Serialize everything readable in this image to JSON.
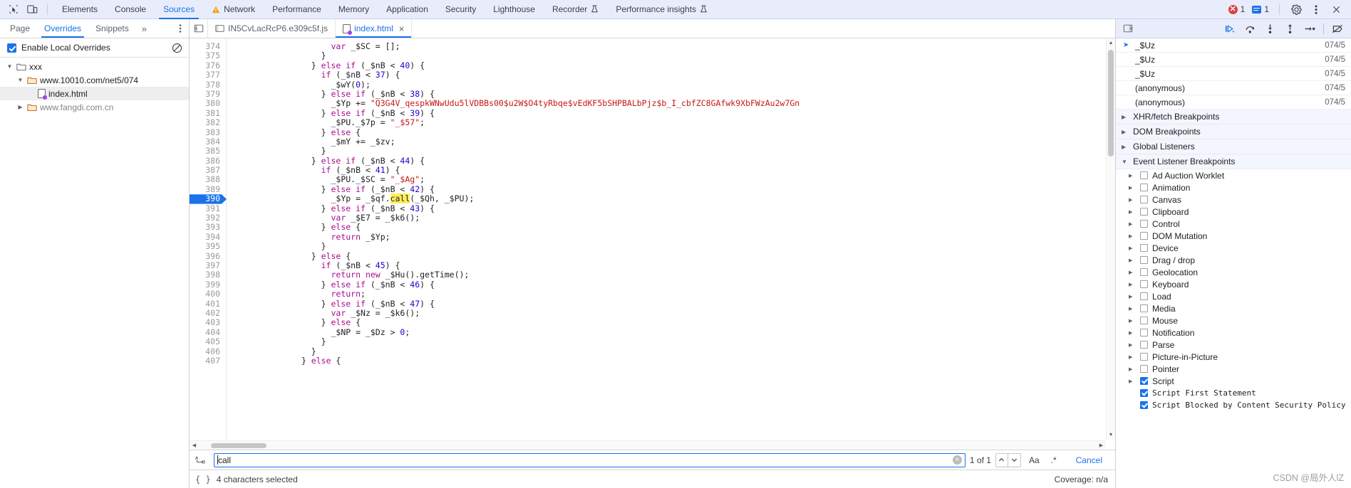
{
  "toolbar": {
    "inspect_icon": "inspect-cursor-icon",
    "device_icon": "device-toggle-icon",
    "tabs": [
      {
        "label": "Elements",
        "active": false,
        "warn": false,
        "flask": false
      },
      {
        "label": "Console",
        "active": false,
        "warn": false,
        "flask": false
      },
      {
        "label": "Sources",
        "active": true,
        "warn": false,
        "flask": false
      },
      {
        "label": "Network",
        "active": false,
        "warn": true,
        "flask": false
      },
      {
        "label": "Performance",
        "active": false,
        "warn": false,
        "flask": false
      },
      {
        "label": "Memory",
        "active": false,
        "warn": false,
        "flask": false
      },
      {
        "label": "Application",
        "active": false,
        "warn": false,
        "flask": false
      },
      {
        "label": "Security",
        "active": false,
        "warn": false,
        "flask": false
      },
      {
        "label": "Lighthouse",
        "active": false,
        "warn": false,
        "flask": false
      },
      {
        "label": "Recorder",
        "active": false,
        "warn": false,
        "flask": true
      },
      {
        "label": "Performance insights",
        "active": false,
        "warn": false,
        "flask": true
      }
    ],
    "error_count": "1",
    "message_count": "1",
    "settings_icon": "gear-icon",
    "kebab_icon": "more-options-icon",
    "close_icon": "close-devtools-icon"
  },
  "navigator": {
    "tabs": [
      {
        "label": "Page",
        "active": false
      },
      {
        "label": "Overrides",
        "active": true
      },
      {
        "label": "Snippets",
        "active": false
      }
    ],
    "more_label": "»",
    "kebab_icon": "more-options-icon",
    "enable_overrides_label": "Enable Local Overrides",
    "enable_overrides_checked": true,
    "clear_icon": "clear-configuration-icon",
    "tree": [
      {
        "label": "xxx",
        "depth": 0,
        "expanded": true,
        "kind": "folder-plain",
        "selected": false,
        "dim": false
      },
      {
        "label": "www.10010.com/net5/074",
        "depth": 1,
        "expanded": true,
        "kind": "folder-override",
        "selected": false,
        "dim": false
      },
      {
        "label": "index.html",
        "depth": 2,
        "expanded": null,
        "kind": "file-override",
        "selected": true,
        "dim": false
      },
      {
        "label": "www.fangdi.com.cn",
        "depth": 1,
        "expanded": false,
        "kind": "folder-override",
        "selected": false,
        "dim": true
      }
    ]
  },
  "editor": {
    "panel_toggle_icon": "show-navigator-icon",
    "tabs": [
      {
        "label": "IN5CvLacRcP6.e309c5f.js",
        "active": false,
        "override": false,
        "closeable": false
      },
      {
        "label": "index.html",
        "active": true,
        "override": true,
        "closeable": true
      }
    ],
    "close_label": "×",
    "first_line": 374,
    "highlight_line": 390,
    "lines": [
      {
        "n": 374,
        "indent": 20,
        "tokens": [
          [
            "kw",
            "var"
          ],
          [
            "pl",
            " _$SC = [];"
          ]
        ]
      },
      {
        "n": 375,
        "indent": 18,
        "tokens": [
          [
            "pl",
            "}"
          ]
        ]
      },
      {
        "n": 376,
        "indent": 16,
        "tokens": [
          [
            "pl",
            "} "
          ],
          [
            "kw",
            "else if"
          ],
          [
            "pl",
            " (_$nB < "
          ],
          [
            "num",
            "40"
          ],
          [
            "pl",
            ") {"
          ]
        ]
      },
      {
        "n": 377,
        "indent": 18,
        "tokens": [
          [
            "kw",
            "if"
          ],
          [
            "pl",
            " (_$nB < "
          ],
          [
            "num",
            "37"
          ],
          [
            "pl",
            ") {"
          ]
        ]
      },
      {
        "n": 378,
        "indent": 20,
        "tokens": [
          [
            "pl",
            "_$wY("
          ],
          [
            "num",
            "0"
          ],
          [
            "pl",
            ");"
          ]
        ]
      },
      {
        "n": 379,
        "indent": 18,
        "tokens": [
          [
            "pl",
            "} "
          ],
          [
            "kw",
            "else if"
          ],
          [
            "pl",
            " (_$nB < "
          ],
          [
            "num",
            "38"
          ],
          [
            "pl",
            ") {"
          ]
        ]
      },
      {
        "n": 380,
        "indent": 20,
        "tokens": [
          [
            "pl",
            "_$Yp += "
          ],
          [
            "str",
            "\"Q3G4V_qespkWNwUdu5lVDBBs00$u2W$O4tyRbqe$vEdKF5bSHPBALbPjz$b_I_cbfZC8GAfwk9XbFWzAu2w7Gn"
          ]
        ]
      },
      {
        "n": 381,
        "indent": 18,
        "tokens": [
          [
            "pl",
            "} "
          ],
          [
            "kw",
            "else if"
          ],
          [
            "pl",
            " (_$nB < "
          ],
          [
            "num",
            "39"
          ],
          [
            "pl",
            ") {"
          ]
        ]
      },
      {
        "n": 382,
        "indent": 20,
        "tokens": [
          [
            "pl",
            "_$PU._$7p = "
          ],
          [
            "str",
            "\"_$57\""
          ],
          [
            "pl",
            ";"
          ]
        ]
      },
      {
        "n": 383,
        "indent": 18,
        "tokens": [
          [
            "pl",
            "} "
          ],
          [
            "kw",
            "else"
          ],
          [
            "pl",
            " {"
          ]
        ]
      },
      {
        "n": 384,
        "indent": 20,
        "tokens": [
          [
            "pl",
            "_$mY += _$zv;"
          ]
        ]
      },
      {
        "n": 385,
        "indent": 18,
        "tokens": [
          [
            "pl",
            "}"
          ]
        ]
      },
      {
        "n": 386,
        "indent": 16,
        "tokens": [
          [
            "pl",
            "} "
          ],
          [
            "kw",
            "else if"
          ],
          [
            "pl",
            " (_$nB < "
          ],
          [
            "num",
            "44"
          ],
          [
            "pl",
            ") {"
          ]
        ]
      },
      {
        "n": 387,
        "indent": 18,
        "tokens": [
          [
            "kw",
            "if"
          ],
          [
            "pl",
            " (_$nB < "
          ],
          [
            "num",
            "41"
          ],
          [
            "pl",
            ") {"
          ]
        ]
      },
      {
        "n": 388,
        "indent": 20,
        "tokens": [
          [
            "pl",
            "_$PU._$SC = "
          ],
          [
            "str",
            "\"_$Ag\""
          ],
          [
            "pl",
            ";"
          ]
        ]
      },
      {
        "n": 389,
        "indent": 18,
        "tokens": [
          [
            "pl",
            "} "
          ],
          [
            "kw",
            "else if"
          ],
          [
            "pl",
            " (_$nB < "
          ],
          [
            "num",
            "42"
          ],
          [
            "pl",
            ") {"
          ]
        ]
      },
      {
        "n": 390,
        "indent": 20,
        "tokens": [
          [
            "pl",
            "_$Yp = _$qf."
          ],
          [
            "mark",
            "call"
          ],
          [
            "pl",
            "(_$Qh, _$PU);"
          ]
        ]
      },
      {
        "n": 391,
        "indent": 18,
        "tokens": [
          [
            "pl",
            "} "
          ],
          [
            "kw",
            "else if"
          ],
          [
            "pl",
            " (_$nB < "
          ],
          [
            "num",
            "43"
          ],
          [
            "pl",
            ") {"
          ]
        ]
      },
      {
        "n": 392,
        "indent": 20,
        "tokens": [
          [
            "kw",
            "var"
          ],
          [
            "pl",
            " _$E7 = _$k6();"
          ]
        ]
      },
      {
        "n": 393,
        "indent": 18,
        "tokens": [
          [
            "pl",
            "} "
          ],
          [
            "kw",
            "else"
          ],
          [
            "pl",
            " {"
          ]
        ]
      },
      {
        "n": 394,
        "indent": 20,
        "tokens": [
          [
            "kw",
            "return"
          ],
          [
            "pl",
            " _$Yp;"
          ]
        ]
      },
      {
        "n": 395,
        "indent": 18,
        "tokens": [
          [
            "pl",
            "}"
          ]
        ]
      },
      {
        "n": 396,
        "indent": 16,
        "tokens": [
          [
            "pl",
            "} "
          ],
          [
            "kw",
            "else"
          ],
          [
            "pl",
            " {"
          ]
        ]
      },
      {
        "n": 397,
        "indent": 18,
        "tokens": [
          [
            "kw",
            "if"
          ],
          [
            "pl",
            " (_$nB < "
          ],
          [
            "num",
            "45"
          ],
          [
            "pl",
            ") {"
          ]
        ]
      },
      {
        "n": 398,
        "indent": 20,
        "tokens": [
          [
            "kw",
            "return new"
          ],
          [
            "pl",
            " _$Hu().getTime();"
          ]
        ]
      },
      {
        "n": 399,
        "indent": 18,
        "tokens": [
          [
            "pl",
            "} "
          ],
          [
            "kw",
            "else if"
          ],
          [
            "pl",
            " (_$nB < "
          ],
          [
            "num",
            "46"
          ],
          [
            "pl",
            ") {"
          ]
        ]
      },
      {
        "n": 400,
        "indent": 20,
        "tokens": [
          [
            "kw",
            "return"
          ],
          [
            "pl",
            ";"
          ]
        ]
      },
      {
        "n": 401,
        "indent": 18,
        "tokens": [
          [
            "pl",
            "} "
          ],
          [
            "kw",
            "else if"
          ],
          [
            "pl",
            " (_$nB < "
          ],
          [
            "num",
            "47"
          ],
          [
            "pl",
            ") {"
          ]
        ]
      },
      {
        "n": 402,
        "indent": 20,
        "tokens": [
          [
            "kw",
            "var"
          ],
          [
            "pl",
            " _$Nz = _$k6();"
          ]
        ]
      },
      {
        "n": 403,
        "indent": 18,
        "tokens": [
          [
            "pl",
            "} "
          ],
          [
            "kw",
            "else"
          ],
          [
            "pl",
            " {"
          ]
        ]
      },
      {
        "n": 404,
        "indent": 20,
        "tokens": [
          [
            "pl",
            "_$NP = _$Dz > "
          ],
          [
            "num",
            "0"
          ],
          [
            "pl",
            ";"
          ]
        ]
      },
      {
        "n": 405,
        "indent": 18,
        "tokens": [
          [
            "pl",
            "}"
          ]
        ]
      },
      {
        "n": 406,
        "indent": 16,
        "tokens": [
          [
            "pl",
            "}"
          ]
        ]
      },
      {
        "n": 407,
        "indent": 14,
        "tokens": [
          [
            "pl",
            "} "
          ],
          [
            "kw",
            "else"
          ],
          [
            "pl",
            " {"
          ]
        ]
      }
    ]
  },
  "search": {
    "regex_icon": "match-case-icon",
    "value": "call",
    "placeholder": "Find",
    "clear_label": "×",
    "match_count": "1 of 1",
    "prev_label": "⌃",
    "next_label": "⌄",
    "match_case_label": "Aa",
    "regex_label": ".*",
    "cancel_label": "Cancel"
  },
  "status": {
    "format_icon": "pretty-print-icon",
    "selection_text": "4 characters selected",
    "coverage_text": "Coverage: n/a"
  },
  "debugger": {
    "toolbar": {
      "collapse_icon": "show-debugger-sidebar-icon",
      "buttons": [
        {
          "icon": "resume-script-icon",
          "name": "resume-button"
        },
        {
          "icon": "step-over-icon",
          "name": "step-over-button"
        },
        {
          "icon": "step-into-icon",
          "name": "step-into-button"
        },
        {
          "icon": "step-out-icon",
          "name": "step-out-button"
        },
        {
          "icon": "step-icon",
          "name": "step-button"
        },
        {
          "icon": "deactivate-breakpoints-icon",
          "name": "deactivate-breakpoints-button"
        }
      ]
    },
    "call_stack": [
      {
        "name": "_$Uz",
        "location": "074/5",
        "current": true
      },
      {
        "name": "_$Uz",
        "location": "074/5",
        "current": false
      },
      {
        "name": "_$Uz",
        "location": "074/5",
        "current": false
      },
      {
        "name": "(anonymous)",
        "location": "074/5",
        "current": false
      },
      {
        "name": "(anonymous)",
        "location": "074/5",
        "current": false
      }
    ],
    "sections": [
      {
        "title": "XHR/fetch Breakpoints",
        "expanded": false
      },
      {
        "title": "DOM Breakpoints",
        "expanded": false
      },
      {
        "title": "Global Listeners",
        "expanded": false
      },
      {
        "title": "Event Listener Breakpoints",
        "expanded": true
      }
    ],
    "event_categories": [
      {
        "label": "Ad Auction Worklet",
        "checked": false
      },
      {
        "label": "Animation",
        "checked": false
      },
      {
        "label": "Canvas",
        "checked": false
      },
      {
        "label": "Clipboard",
        "checked": false
      },
      {
        "label": "Control",
        "checked": false
      },
      {
        "label": "DOM Mutation",
        "checked": false
      },
      {
        "label": "Device",
        "checked": false
      },
      {
        "label": "Drag / drop",
        "checked": false
      },
      {
        "label": "Geolocation",
        "checked": false
      },
      {
        "label": "Keyboard",
        "checked": false
      },
      {
        "label": "Load",
        "checked": false
      },
      {
        "label": "Media",
        "checked": false
      },
      {
        "label": "Mouse",
        "checked": false
      },
      {
        "label": "Notification",
        "checked": false
      },
      {
        "label": "Parse",
        "checked": false
      },
      {
        "label": "Picture-in-Picture",
        "checked": false
      },
      {
        "label": "Pointer",
        "checked": false
      },
      {
        "label": "Script",
        "checked": true
      }
    ],
    "script_sub_items": [
      {
        "label": "Script First Statement",
        "checked": true
      },
      {
        "label": "Script Blocked by Content Security Policy",
        "checked": true
      }
    ]
  },
  "watermark": {
    "text": "CSDN @局外人lZ"
  },
  "colors": {
    "accent": "#1a73e8",
    "toolbar_bg": "#e9edfb",
    "error": "#e03e3e",
    "highlight": "#ffee5b"
  }
}
